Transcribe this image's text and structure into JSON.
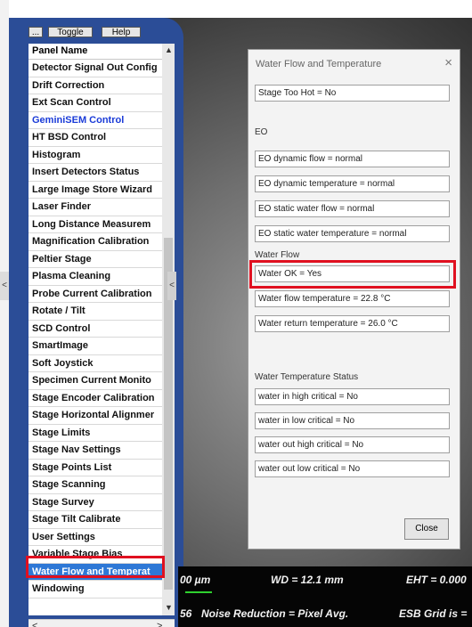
{
  "toolbar": {
    "dots_label": "...",
    "toggle_label": "Toggle",
    "help_label": "Help"
  },
  "panel_list": {
    "header": "Panel Name",
    "items": [
      {
        "label": "Detector Signal Out Config"
      },
      {
        "label": "Drift Correction"
      },
      {
        "label": "Ext Scan Control"
      },
      {
        "label": "GeminiSEM Control"
      },
      {
        "label": "HT BSD Control"
      },
      {
        "label": "Histogram"
      },
      {
        "label": "Insert Detectors Status"
      },
      {
        "label": "Large Image Store Wizard"
      },
      {
        "label": "Laser Finder"
      },
      {
        "label": "Long Distance Measurem"
      },
      {
        "label": "Magnification Calibration"
      },
      {
        "label": "Peltier Stage"
      },
      {
        "label": "Plasma Cleaning"
      },
      {
        "label": "Probe Current Calibration"
      },
      {
        "label": "Rotate / Tilt"
      },
      {
        "label": "SCD Control"
      },
      {
        "label": "SmartImage"
      },
      {
        "label": "Soft Joystick"
      },
      {
        "label": "Specimen Current Monito"
      },
      {
        "label": "Stage Encoder Calibration"
      },
      {
        "label": "Stage Horizontal Alignmer"
      },
      {
        "label": "Stage Limits"
      },
      {
        "label": "Stage Nav Settings"
      },
      {
        "label": "Stage Points List"
      },
      {
        "label": "Stage Scanning"
      },
      {
        "label": "Stage Survey"
      },
      {
        "label": "Stage Tilt Calibrate"
      },
      {
        "label": "User Settings"
      },
      {
        "label": "Variable Stage Bias"
      },
      {
        "label": "Water Flow and Temperat"
      },
      {
        "label": "Windowing"
      }
    ],
    "highlight_color": "#1a3bd8",
    "selected_color": "#2e78d6"
  },
  "scrollbar": {
    "left_arrow": "<",
    "right_arrow": ">",
    "side_left": "<",
    "side_mid": "<"
  },
  "dialog": {
    "title": "Water Flow and Temperature",
    "close_icon": "×",
    "stage_too_hot": "Stage Too Hot = No",
    "eo_section": "EO",
    "eo_dynamic_flow": "EO dynamic flow = normal",
    "eo_dynamic_temperature": "EO dynamic temperature = normal",
    "eo_static_water_flow": "EO static water flow = normal",
    "eo_static_water_temperature": "EO static water temperature = normal",
    "water_flow_section": "Water Flow",
    "water_ok": "Water OK = Yes",
    "water_flow_temperature": "Water flow temperature =  22.8 °C",
    "water_return_temperature": "Water return temperature =  26.0 °C",
    "water_temp_status_section": "Water Temperature Status",
    "water_in_high_critical": "water in high critical = No",
    "water_in_low_critical": "water in low critical = No",
    "water_out_high_critical": "water out high critical = No",
    "water_out_low_critical": "water out low critical = No",
    "close_button": "Close"
  },
  "statusbar": {
    "scale": "00 µm",
    "wd": "WD = 12.1 mm",
    "eht": "EHT = 0.000",
    "frag": "56",
    "noise": "Noise Reduction = Pixel Avg.",
    "esb": "ESB Grid is ="
  },
  "annotation_color": "#e01020"
}
